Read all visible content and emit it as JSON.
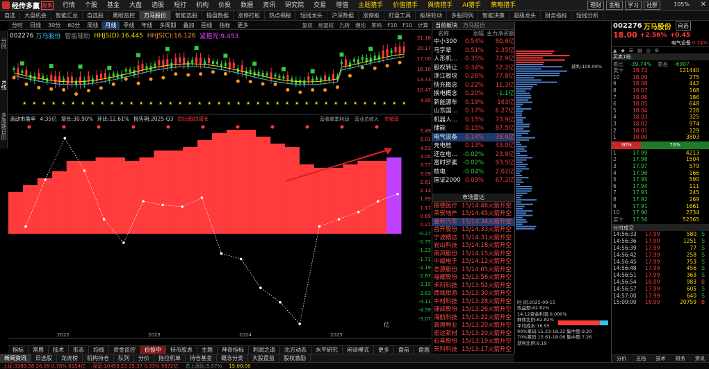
{
  "title_bar": {
    "app_name": "经传多赢",
    "badge": "股事",
    "menu": [
      "行情",
      "个股",
      "基金",
      "大盘",
      "选股",
      "短打",
      "机构",
      "价投",
      "数据",
      "资讯",
      "研究院",
      "交易",
      "增值",
      "主题猎手",
      "价值猎手",
      "與情猎手",
      "AI猎手",
      "策略猎手"
    ],
    "right_buttons": [
      "理财",
      "金融",
      "学习",
      "社群"
    ],
    "zoom": "105%"
  },
  "toolbar": {
    "tabs": [
      "自选",
      "大盘机会",
      "智能汇总",
      "自选股",
      "鹰眼监控",
      "万马股份",
      "智能选股",
      "操盘数据",
      "涨停打板",
      "热点揭秘",
      "短线龙头",
      "沪深数据",
      "涨停板",
      "盯盘工具",
      "板块轮动",
      "多股同列",
      "智能决策",
      "超级龙头",
      "财务指标",
      "短线分析"
    ],
    "active": "万马股份"
  },
  "chart_toolbar": {
    "items": [
      "分时",
      "日线",
      "30分",
      "60分",
      "周线",
      "月线",
      "季线",
      "年线",
      "多周期",
      "叠加",
      "画线",
      "指标",
      "更多"
    ],
    "right": [
      "复权",
      "前复权",
      "九转",
      "缠论",
      "筹码",
      "F10",
      "F10",
      "计算"
    ],
    "active": "月线"
  },
  "kline": {
    "code": "002276",
    "name": "万马股份",
    "lines": [
      "智能辅助",
      "HHJS(D):16.445",
      "HHJS(C):16.126",
      "紧箍咒:9.453"
    ],
    "price_ticks": [
      "21.18",
      "20.17",
      "17.00",
      "16.10",
      "13.73",
      "10.47",
      "4.95"
    ],
    "labels": {
      "high": "21.18",
      "mid": "16.10-19.29",
      "low": "4.95"
    }
  },
  "sub_chart": {
    "legend": [
      "滚动市盈率",
      "4.35亿",
      "增长:30.90%",
      "环比:12.61%",
      "报告期:2025-Q3",
      "同比趋同增长"
    ],
    "right_legend": [
      "营收单季利润",
      "营业总收入",
      "市销率"
    ],
    "unit": "亿",
    "years": [
      "2022",
      "2023",
      "2024",
      "2025"
    ],
    "y_ticks": [
      "5.49",
      "5.01",
      "4.53",
      "4.05",
      "3.57",
      "3.09",
      "2.61",
      "2.13",
      "1.65",
      "1.17",
      "0.69",
      "0.21",
      "-0.27",
      "-0.75",
      "-1.23",
      "-1.71",
      "-2.19",
      "-2.67",
      "-3.15",
      "-3.63",
      "-4.11",
      "-4.59",
      "-5.07"
    ]
  },
  "bottom_tabs": {
    "row1": [
      "指标",
      "常用",
      "技术",
      "形态",
      "均线",
      "资金监控",
      "持币股息",
      "主题",
      "神奇指标",
      "利润之道",
      "北方动态",
      "水平研究",
      "闲谈模式",
      "更多",
      "盘前",
      "盘面",
      "盘中"
    ],
    "row2": [
      "新闻资讯",
      "日选股",
      "龙虎榜",
      "机构持仓",
      "队列",
      "分价",
      "拖拉机单",
      "持仓基金",
      "概念分类",
      "大股盘监",
      "股权激励"
    ],
    "active_row1": "价投中",
    "active_row2": "新闻资讯"
  },
  "status_bar": {
    "index_text": "上证:3389.58 26.09 0.78% 8154亿",
    "index2": "深证:10459.23 35.37 0.33% 9872亿",
    "time": "15:00:00",
    "volume_text": "总上涨比:5.57%"
  },
  "sector_panel": {
    "header": "当前板块",
    "header2": "万马股份",
    "cols": [
      "名称",
      "涨幅",
      "主力净买额"
    ],
    "rows": [
      [
        "中小300",
        "0.54%",
        "80.6亿"
      ],
      [
        "马字辈",
        "0.51%",
        "2.35亿"
      ],
      [
        "人形机...",
        "0.35%",
        "72.9亿"
      ],
      [
        "股权转让",
        "0.34%",
        "52.2亿"
      ],
      [
        "浙江板块",
        "0.26%",
        "77.8亿"
      ],
      [
        "快充概念",
        "0.22%",
        "11.3亿"
      ],
      [
        "换电概念",
        "0.20%",
        "-1.1亿"
      ],
      [
        "新能源车",
        "0.19%",
        "163亿"
      ],
      [
        "山东国...",
        "0.17%",
        "6.27亿"
      ],
      [
        "机器人...",
        "0.15%",
        "73.9亿"
      ],
      [
        "储能",
        "0.15%",
        "87.5亿"
      ],
      [
        "电气设备",
        "0.14%",
        "39.6亿"
      ],
      [
        "充电桩",
        "0.13%",
        "43.0亿"
      ],
      [
        "还在电...",
        "-0.02%",
        "23.9亿"
      ],
      [
        "富时罗素",
        "-0.02%",
        "93.5亿"
      ],
      [
        "核电",
        "-0.04%",
        "2.02亿"
      ],
      [
        "国证2000",
        "0.09%",
        "67.2亿"
      ]
    ],
    "highlight": "电气设备"
  },
  "market_panel": {
    "header": "市场雷达",
    "rows": [
      [
        "振德医疗",
        "15/14:46",
        "火箭升空"
      ],
      [
        "荣安地产",
        "15/14:45",
        "火箭升空"
      ],
      [
        "金杯汽车",
        "15/14:34",
        "火箭升空"
      ],
      [
        "首开股份",
        "15/14:33",
        "火箭升空"
      ],
      [
        "宁波精达",
        "15/14:31",
        "火箭升空"
      ],
      [
        "岩山科技",
        "15/14:18",
        "火箭升空"
      ],
      [
        "南风股份",
        "15/14:15",
        "火箭升空"
      ],
      [
        "中威电子",
        "15/14:12",
        "火箭升空"
      ],
      [
        "总源股份",
        "15/14:05",
        "火箭升空"
      ],
      [
        "福耀股份",
        "15/13:56",
        "火箭升空"
      ],
      [
        "禾科科技",
        "15/13:52",
        "火箭升空"
      ],
      [
        "西域旅游",
        "15/13:30",
        "火箭升空"
      ],
      [
        "中材科技",
        "15/13:28",
        "火箭升空"
      ],
      [
        "捷成股份",
        "15/13:26",
        "火箭升空"
      ],
      [
        "海航科技",
        "15/13:22",
        "火箭升空"
      ],
      [
        "敦煌种业",
        "15/13:20",
        "火箭升空"
      ],
      [
        "宏达新材",
        "15/13:20",
        "火箭升空"
      ],
      [
        "石基股份",
        "15/13:19",
        "火箭升空"
      ],
      [
        "天科科技",
        "15/13:17",
        "火箭升空"
      ]
    ],
    "highlight": "金杯汽车",
    "info": [
      "时  间:2025-09-15",
      "收益期:82.82%",
      "14.12资金利润:0.000%",
      "群体比例:82.82%",
      "平均成本:16.95",
      "90%筹码:15.23-18.32 集中度:9.20",
      "70%筹码:15.61-18.06 集中度:7.26",
      "获利比例:6.19"
    ]
  },
  "quote": {
    "code": "002276",
    "name": "万马股份",
    "tag": "自选",
    "price": "18.00",
    "change_pct": "+2.56%",
    "change": "+0.45",
    "tags": [
      "电气设备",
      "0.14%"
    ],
    "webi": "-39.74%",
    "wc": "-6907",
    "ask_label": "委比",
    "wc_label": "委差",
    "buy_head": "买卖1档",
    "asks": [
      [
        "卖十",
        "18.72",
        "121440"
      ],
      [
        "10",
        "18.09",
        "275"
      ],
      [
        "9",
        "18.08",
        "442"
      ],
      [
        "8",
        "18.07",
        "168"
      ],
      [
        "7",
        "18.06",
        "186"
      ],
      [
        "6",
        "18.05",
        "648"
      ],
      [
        "5",
        "18.04",
        "228"
      ],
      [
        "4",
        "18.03",
        "325"
      ],
      [
        "3",
        "18.02",
        "974"
      ],
      [
        "2",
        "18.01",
        "129"
      ],
      [
        "1",
        "18.00",
        "3803"
      ]
    ],
    "ratio": [
      "30%",
      "70%"
    ],
    "bids": [
      [
        "1",
        "17.99",
        "4213"
      ],
      [
        "2",
        "17.98",
        "1504"
      ],
      [
        "3",
        "17.97",
        "579"
      ],
      [
        "4",
        "17.96",
        "166"
      ],
      [
        "5",
        "17.95",
        "590"
      ],
      [
        "6",
        "17.94",
        "111"
      ],
      [
        "7",
        "17.93",
        "245"
      ],
      [
        "8",
        "17.92",
        "269"
      ],
      [
        "9",
        "17.91",
        "1661"
      ],
      [
        "10",
        "17.90",
        "2734"
      ],
      [
        "买十",
        "17.56",
        "52365"
      ]
    ],
    "trades_header": "分时成交",
    "trades": [
      [
        "14:56:33",
        "17.99",
        "580",
        "S"
      ],
      [
        "14:56:36",
        "17.99",
        "1251",
        "S"
      ],
      [
        "14:56:39",
        "17.99",
        "77",
        "S"
      ],
      [
        "14:56:42",
        "17.99",
        "258",
        "S"
      ],
      [
        "14:56:45",
        "17.99",
        "753",
        "S"
      ],
      [
        "14:56:48",
        "17.99",
        "456",
        "S"
      ],
      [
        "14:56:51",
        "17.99",
        "363",
        "S"
      ],
      [
        "14:56:54",
        "18.00",
        "983",
        "B"
      ],
      [
        "14:56:57",
        "17.99",
        "605",
        "S"
      ],
      [
        "14:57:00",
        "17.99",
        "640",
        "S"
      ],
      [
        "15:00:00",
        "18.00",
        "20759",
        "B"
      ]
    ],
    "bottom_tabs": [
      "分价",
      "五档",
      "技术",
      "财务",
      "资讯"
    ]
  },
  "vertical_tabs": [
    "分时",
    "K线",
    "多周期日历"
  ],
  "colors": {
    "bg": "#000000",
    "up": "#ff3b3b",
    "down": "#2ecc40",
    "accent": "#ffd700",
    "bar": "#ff3b3b",
    "current_bar": "#c040ff"
  },
  "pe_series": {
    "values": [
      0.9,
      0.9,
      1.0,
      1.0,
      1.0,
      0.8,
      0.8,
      0.9,
      0.9,
      0.8,
      0.8,
      0.7,
      0.7,
      0.8,
      0.9,
      1.0,
      1.0,
      1.0,
      1.0,
      0.8,
      0.8,
      0.8,
      0.8,
      0.7,
      0.7,
      0.7,
      0.7
    ],
    "line": [
      0.4,
      3.0,
      5.3,
      3.5,
      0.8,
      -0.5,
      1.8,
      1.6,
      1.5,
      2.0,
      -1.1,
      -1.4,
      -3.0,
      -3.8,
      -5.0,
      0.4,
      0.8,
      1.2,
      1.8,
      2.2
    ]
  }
}
